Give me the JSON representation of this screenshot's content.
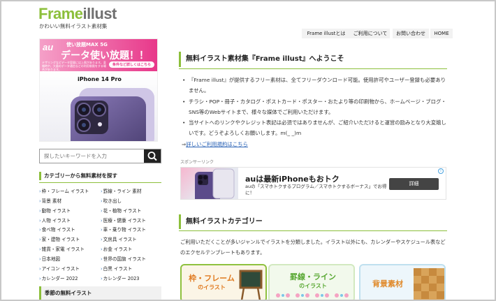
{
  "header": {
    "logo_part1": "Frame",
    "logo_part2": "illust",
    "tagline": "かわいい無料イラスト素材集"
  },
  "nav": {
    "items": [
      "Frame illustとは",
      "ご利用について",
      "お問い合わせ",
      "HOME"
    ]
  },
  "sidebar_ad": {
    "brand": "au",
    "line1": "使い放題MAX 5G",
    "line2": "データ使い放題！！",
    "small_text": "テザリングなどデータ容量には上限があります。混雑時や、大量のデータ通信などの利用制限をする場合があります。",
    "button": "条件など詳しくはこちら",
    "phone_name": "iPhone 14 Pro"
  },
  "search": {
    "placeholder": "探したいキーワードを入力"
  },
  "categories": {
    "title": "カテゴリーから無料素材を探す",
    "left": [
      "枠・フレーム イラスト",
      "背景 素材",
      "動物 イラスト",
      "人物 イラスト",
      "食べ物 イラスト",
      "家・建物 イラスト",
      "雑貨・家電 イラスト",
      "日本地図",
      "アイコン イラスト",
      "カレンダー 2022"
    ],
    "right": [
      "罫線・ライン 素材",
      "吹き出し",
      "花・植物 イラスト",
      "医療・健康 イラスト",
      "車・乗り物 イラスト",
      "文房具 イラスト",
      "お金 イラスト",
      "世界の国旗 イラスト",
      "白黒 イラスト",
      "カレンダー 2023"
    ]
  },
  "season": {
    "title": "季節の無料イラスト"
  },
  "main": {
    "welcome_title": "無料イラスト素材集『Frame illust』へようこそ",
    "bullet1": "『Frame illust』が提供するフリー素材は、全てフリーダウンロード可能。使用許可やユーザー登録も必要ありません。",
    "bullet2": "チラシ・POP・冊子・カタログ・ポストカード・ポスター・おたより等の印刷物から、ホームページ・ブログ・SNS等のWebサイトまで、様々な媒体でご利用いただけます。",
    "bullet3": "当サイトへのリンクやクレジット表記は必須ではありませんが、ご紹介いただけると運営の励みとなり大変嬉しいです。どうぞよろしくお願いします。m(_ _)m",
    "terms_arrow": "⇒",
    "terms_link": "詳しいご利用規約はこちら",
    "sponsor_label": "スポンサーリンク",
    "category_title": "無料イラストカテゴリー",
    "category_desc": "ご利用いただくことが多いジャンルでイラストを分類しました。イラスト以外にも、カレンダーやスケジュール表などのエクセルテンプレートもあります。"
  },
  "main_ad": {
    "title": "auは最新iPhoneもおトク",
    "subtitle": "auの「スマホトクするプログラム／スマホトクするボーナス」でお得に！",
    "button": "詳細",
    "info": "i"
  },
  "banners": {
    "b1_line1": "枠・フレーム",
    "b1_line2": "のイラスト",
    "b2_line1": "罫線・ライン",
    "b2_line2": "のイラスト",
    "b3_line1": "背景素材"
  },
  "colors": {
    "accent": "#8cbf3b",
    "logo_gray": "#707070",
    "link": "#2b63b6",
    "au_pink": "#e8388a"
  }
}
